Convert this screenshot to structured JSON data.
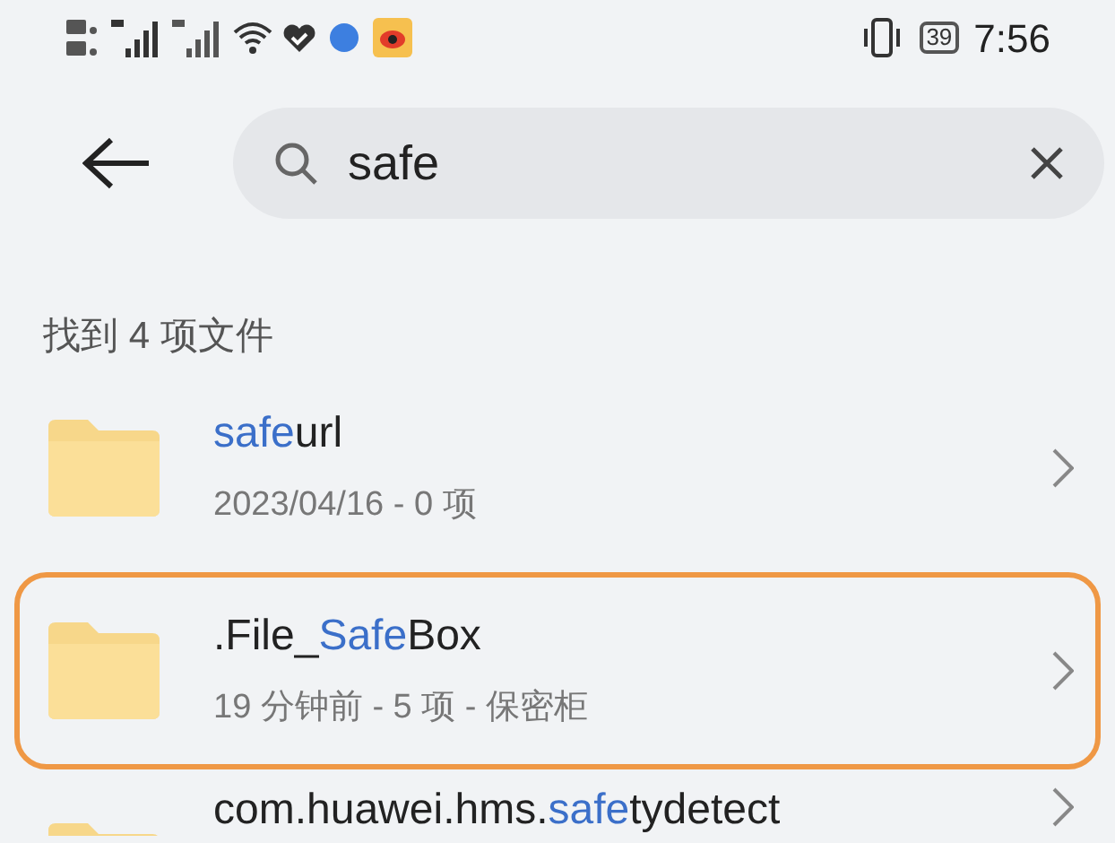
{
  "status_bar": {
    "battery": "39",
    "time": "7:56"
  },
  "search": {
    "value": "safe"
  },
  "result_count": "找到 4 项文件",
  "files": [
    {
      "name_parts": [
        {
          "text": "safe",
          "match": true
        },
        {
          "text": "url",
          "match": false
        }
      ],
      "details": "2023/04/16 - 0 项",
      "highlighted": false
    },
    {
      "name_parts": [
        {
          "text": ".File_",
          "match": false
        },
        {
          "text": "Safe",
          "match": true
        },
        {
          "text": "Box",
          "match": false
        }
      ],
      "details": "19 分钟前 - 5 项 - 保密柜",
      "highlighted": true
    },
    {
      "name_parts": [
        {
          "text": "com.huawei.hms.",
          "match": false
        },
        {
          "text": "safe",
          "match": true
        },
        {
          "text": "tydetect",
          "match": false
        }
      ],
      "highlighted": false
    }
  ]
}
